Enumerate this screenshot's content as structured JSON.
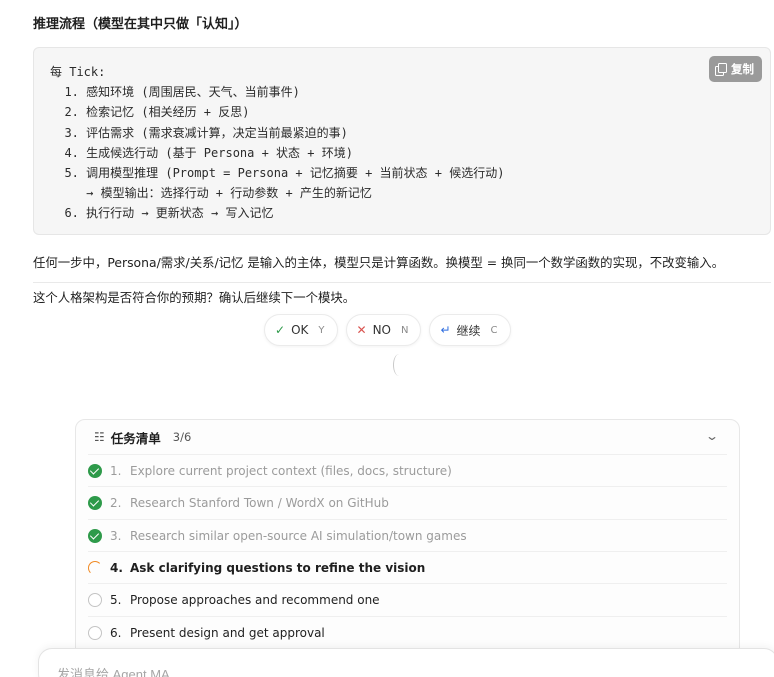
{
  "heading": "推理流程（模型在其中只做「认知」）",
  "code_block": {
    "copy_label": "复制",
    "lines": [
      "每 Tick:",
      "  1. 感知环境 (周围居民、天气、当前事件)",
      "  2. 检索记忆 (相关经历 + 反思)",
      "  3. 评估需求 (需求衰减计算，决定当前最紧迫的事)",
      "  4. 生成候选行动 (基于 Persona + 状态 + 环境)",
      "  5. 调用模型推理 (Prompt = Persona + 记忆摘要 + 当前状态 + 候选行动)",
      "     → 模型输出：选择行动 + 行动参数 + 产生的新记忆",
      "  6. 执行行动 → 更新状态 → 写入记忆"
    ]
  },
  "paragraph1": "任何一步中，Persona/需求/关系/记忆 是输入的主体，模型只是计算函数。换模型 = 换同一个数学函数的实现，不改变输入。",
  "paragraph2": "这个人格架构是否符合你的预期？确认后继续下一个模块。",
  "choices": [
    {
      "icon": "check-icon",
      "label": "OK",
      "key": "Y"
    },
    {
      "icon": "x-icon",
      "label": "NO",
      "key": "N"
    },
    {
      "icon": "return-icon",
      "label": "继续",
      "key": "C"
    }
  ],
  "task_panel": {
    "title": "任务清单",
    "count": "3/6",
    "items": [
      {
        "num": "1.",
        "text": "Explore current project context (files, docs, structure)",
        "status": "done"
      },
      {
        "num": "2.",
        "text": "Research Stanford Town / WordX on GitHub",
        "status": "done"
      },
      {
        "num": "3.",
        "text": "Research similar open-source AI simulation/town games",
        "status": "done"
      },
      {
        "num": "4.",
        "text": "Ask clarifying questions to refine the vision",
        "status": "active"
      },
      {
        "num": "5.",
        "text": "Propose approaches and recommend one",
        "status": "todo"
      },
      {
        "num": "6.",
        "text": "Present design and get approval",
        "status": "todo"
      }
    ]
  },
  "composer": {
    "placeholder": "发消息给 Agent MA"
  },
  "colors": {
    "done": "#2e9a4a",
    "active": "#f08a24",
    "copy_button": "#9a9a9a"
  }
}
